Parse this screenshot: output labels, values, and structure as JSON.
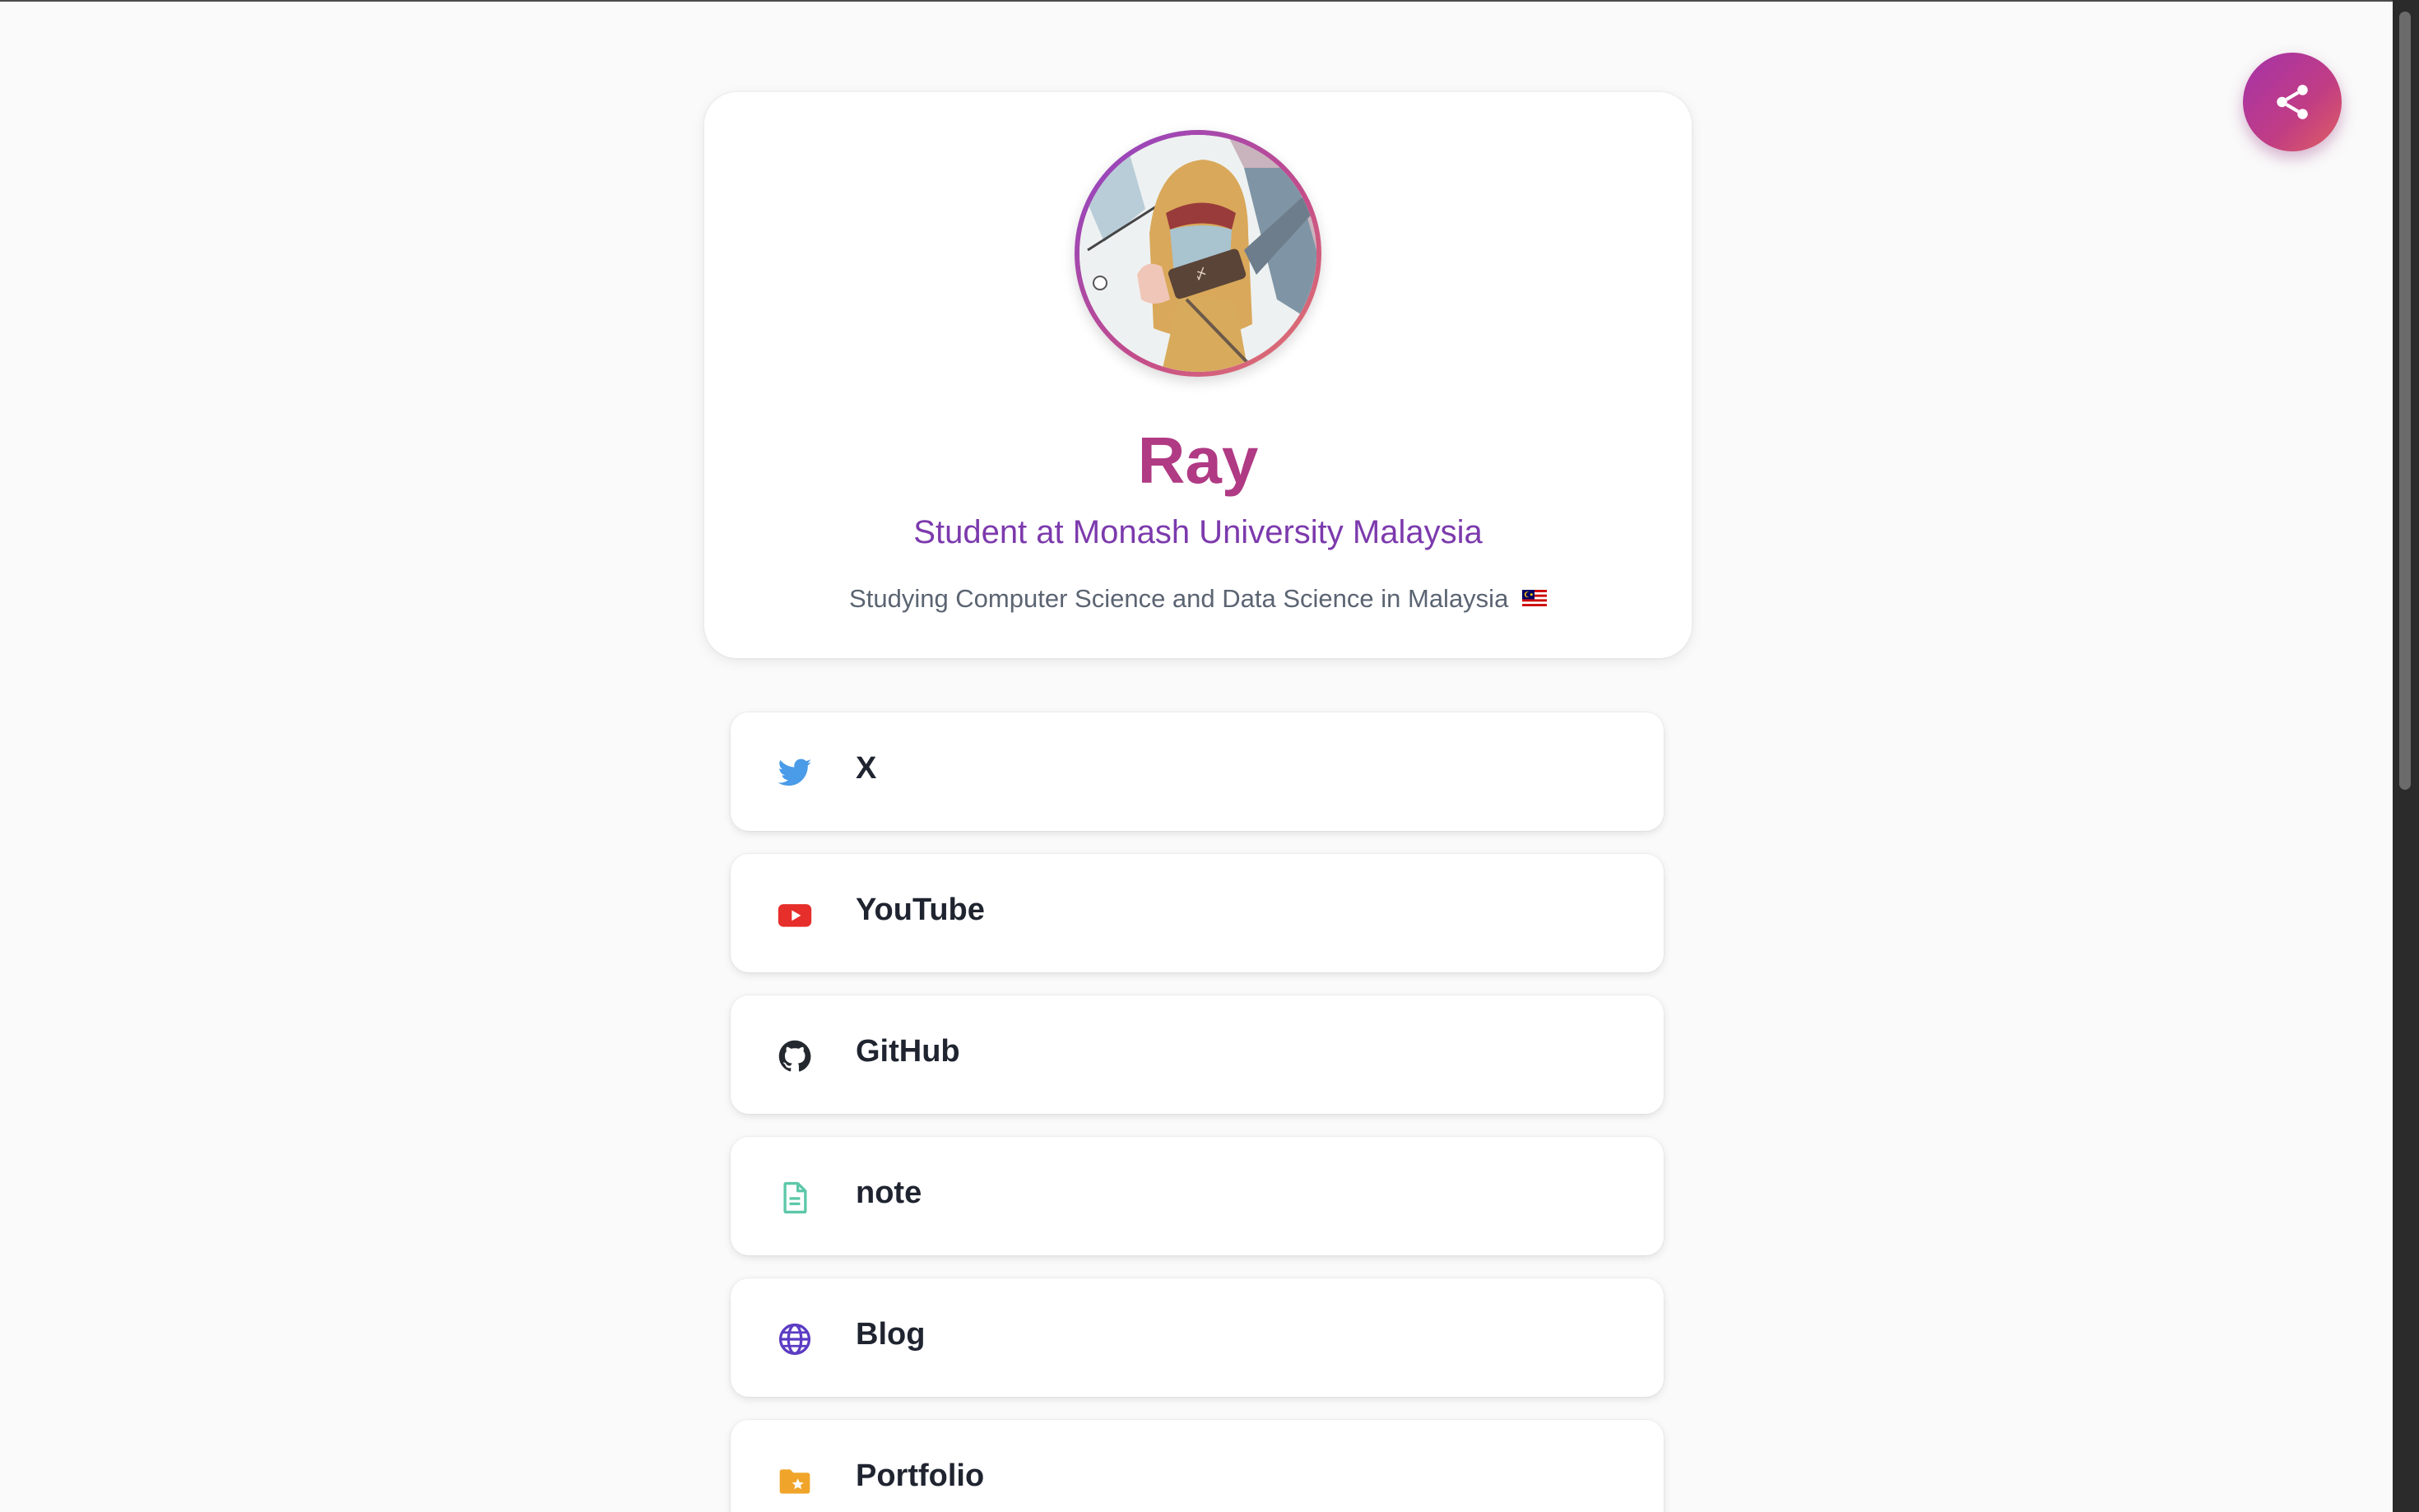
{
  "profile": {
    "name": "Ray",
    "subtitle": "Student at Monash University Malaysia",
    "bio": "Studying Computer Science and Data Science in Malaysia"
  },
  "share_button": {
    "icon": "share-icon"
  },
  "links": [
    {
      "label": "X",
      "icon": "twitter-icon",
      "color": "#4a9be8"
    },
    {
      "label": "YouTube",
      "icon": "youtube-icon",
      "color": "#e62e2a"
    },
    {
      "label": "GitHub",
      "icon": "github-icon",
      "color": "#24292f"
    },
    {
      "label": "note",
      "icon": "document-icon",
      "color": "#5cc7a8"
    },
    {
      "label": "Blog",
      "icon": "globe-icon",
      "color": "#5b3cc4"
    },
    {
      "label": "Portfolio",
      "icon": "folder-star-icon",
      "color": "#f0a52a"
    }
  ],
  "colors": {
    "accent_name": "#b03a84",
    "accent_subtitle": "#7c3aad",
    "background": "#fafafa"
  }
}
